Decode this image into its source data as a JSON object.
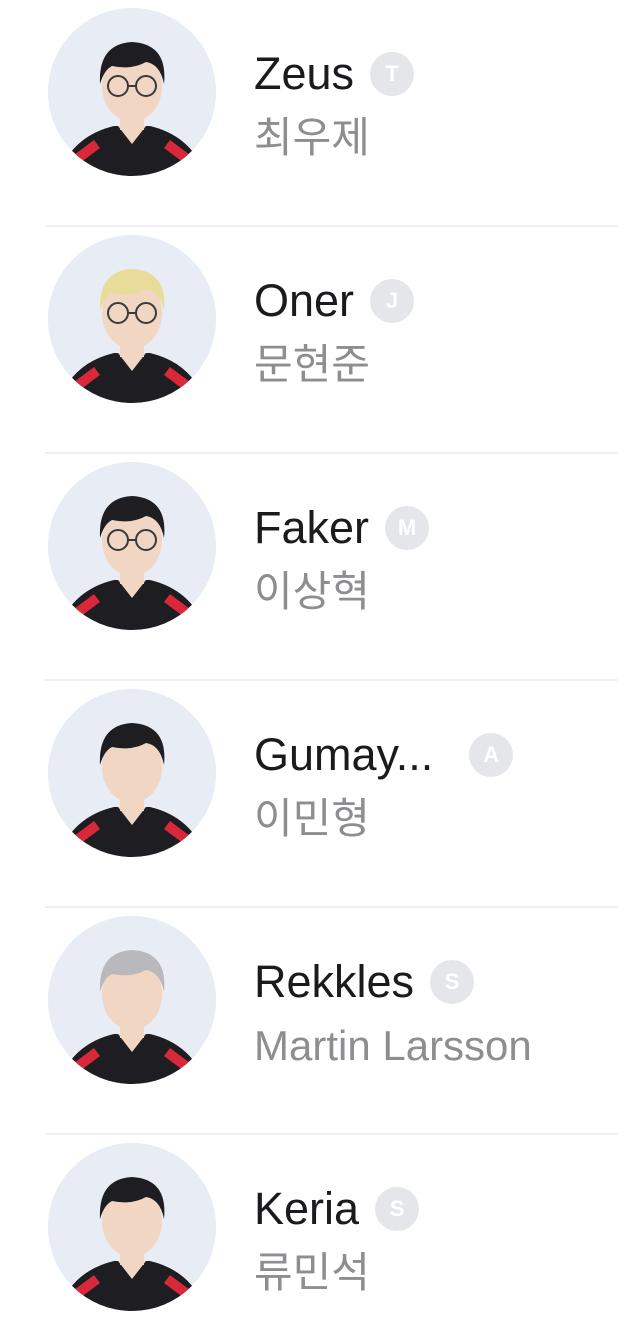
{
  "players": [
    {
      "nickname": "Zeus",
      "role_badge": "T",
      "real_name": "최우제",
      "hair_color": "#1e1e22",
      "glasses": true
    },
    {
      "nickname": "Oner",
      "role_badge": "J",
      "real_name": "문현준",
      "hair_color": "#e9dc9a",
      "glasses": true
    },
    {
      "nickname": "Faker",
      "role_badge": "M",
      "real_name": "이상혁",
      "hair_color": "#1e1e22",
      "glasses": true
    },
    {
      "nickname": "Gumay...",
      "role_badge": "A",
      "real_name": "이민형",
      "hair_color": "#1e1e22",
      "glasses": false
    },
    {
      "nickname": "Rekkles",
      "role_badge": "S",
      "real_name": "Martin Larsson",
      "hair_color": "#b9b9bd",
      "glasses": false
    },
    {
      "nickname": "Keria",
      "role_badge": "S",
      "real_name": "류민석",
      "hair_color": "#1e1e22",
      "glasses": false
    }
  ],
  "colors": {
    "avatar_bg": "#e8ecf5",
    "badge_bg": "#e4e6ea",
    "nickname_text": "#1b1b1f",
    "realname_text": "#8d8d92",
    "divider": "#f0f0f2",
    "jersey": "#1d1d22",
    "jersey_accent": "#d8283a",
    "skin": "#f1d6c4"
  }
}
